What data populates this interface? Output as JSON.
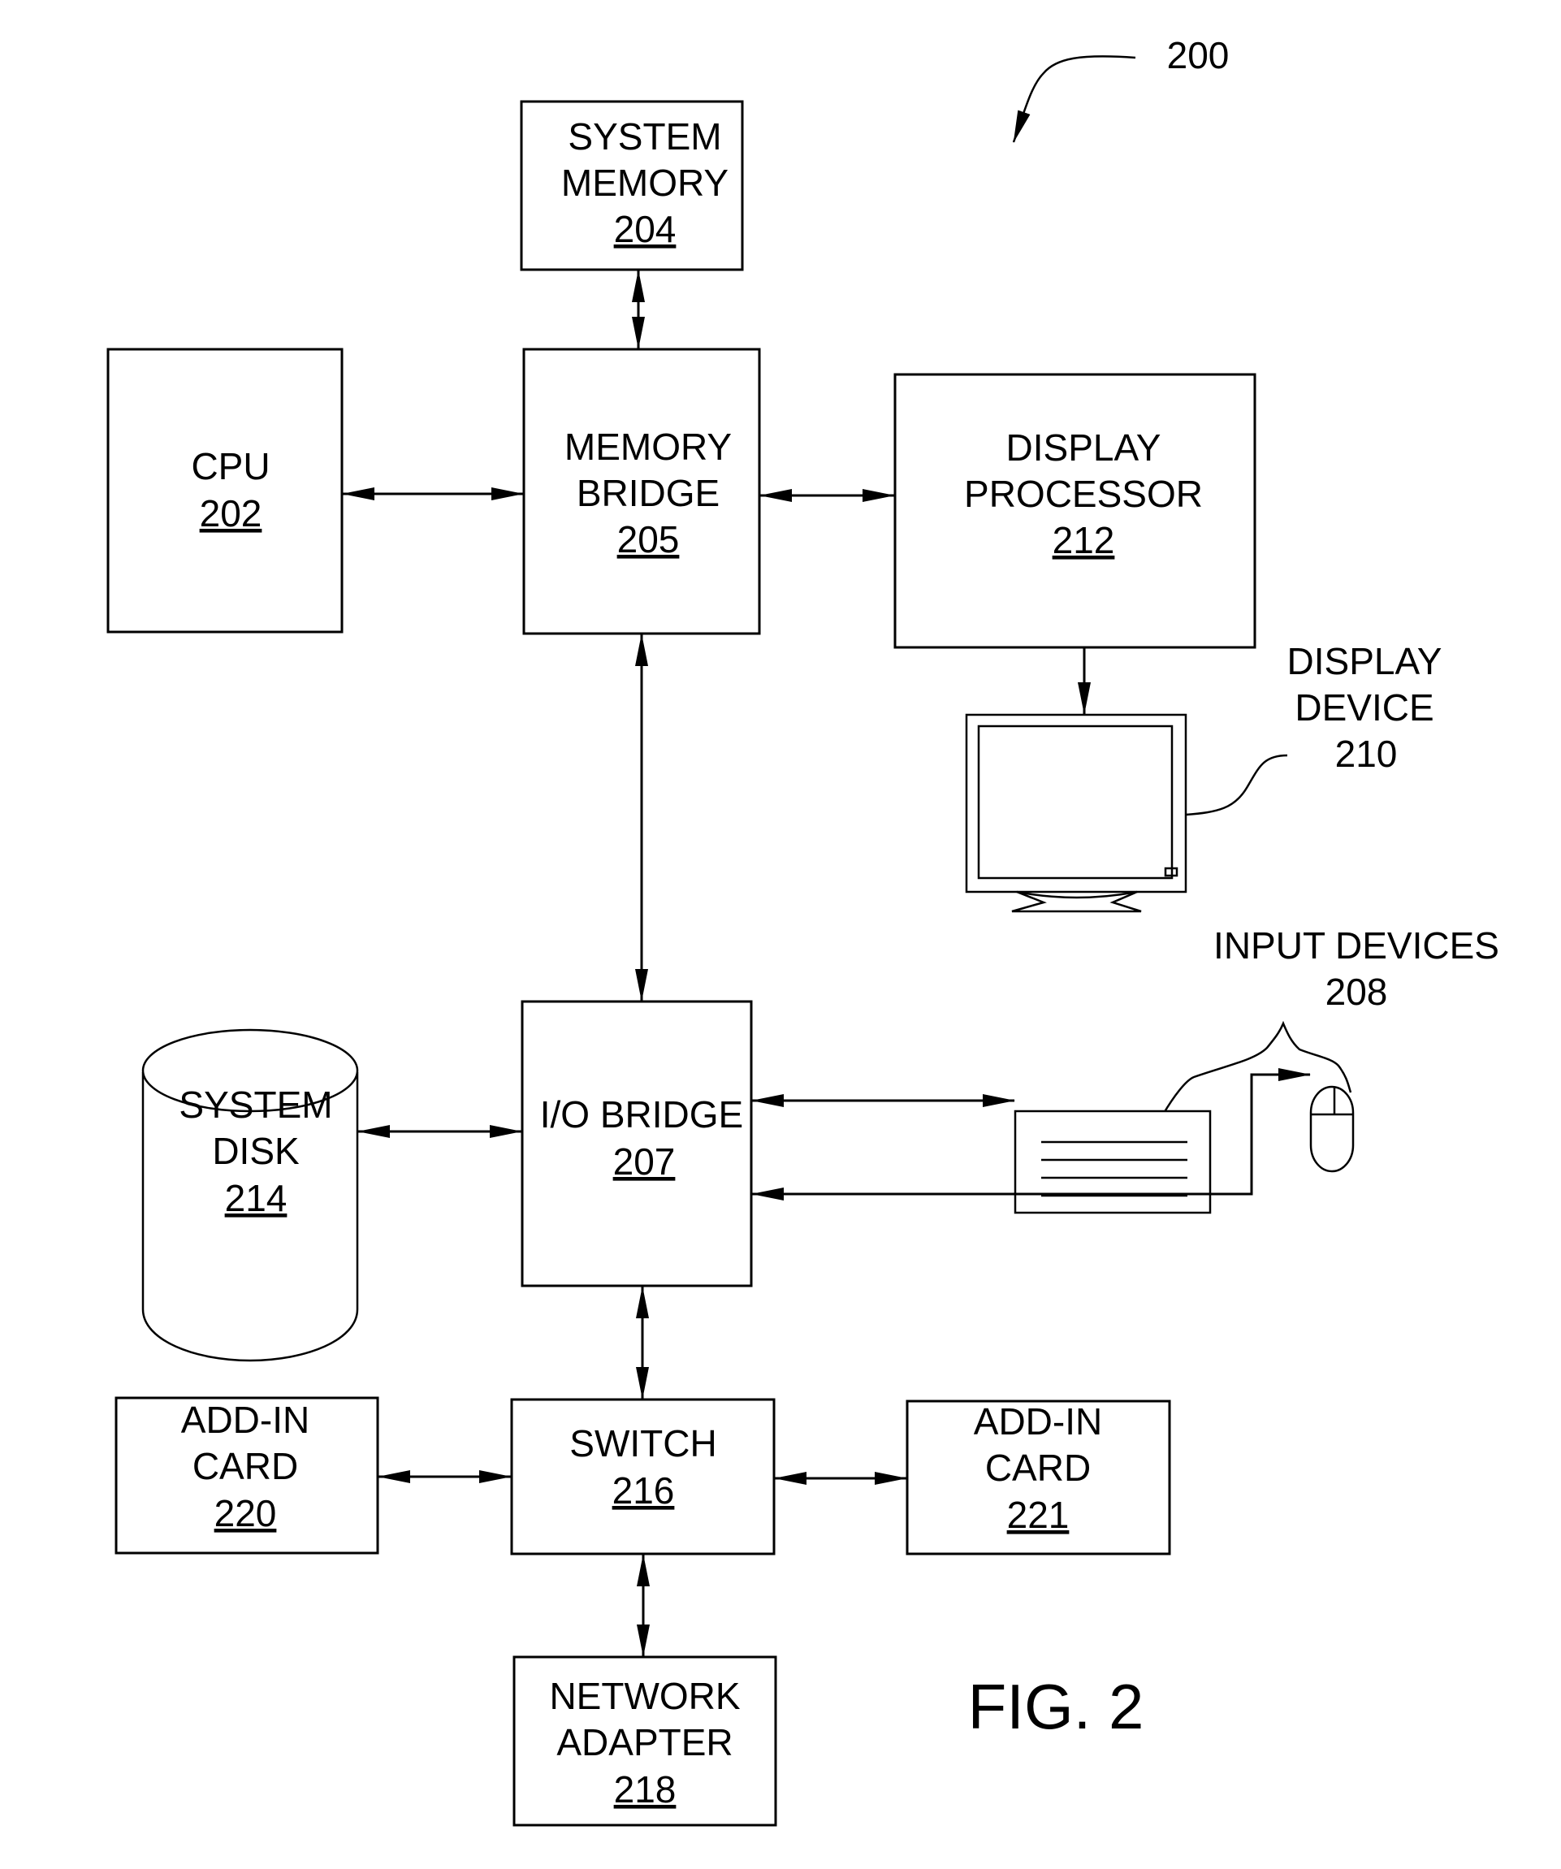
{
  "figure": {
    "label": "FIG. 2",
    "reference_number": "200"
  },
  "blocks": {
    "system_memory": {
      "lines": [
        "SYSTEM",
        "MEMORY"
      ],
      "number": "204"
    },
    "cpu": {
      "lines": [
        "CPU"
      ],
      "number": "202"
    },
    "memory_bridge": {
      "lines": [
        "MEMORY",
        "BRIDGE"
      ],
      "number": "205"
    },
    "display_processor": {
      "lines": [
        "DISPLAY",
        "PROCESSOR"
      ],
      "number": "212"
    },
    "display_device": {
      "lines": [
        "DISPLAY",
        "DEVICE"
      ],
      "number": "210"
    },
    "input_devices": {
      "lines": [
        "INPUT DEVICES"
      ],
      "number": "208"
    },
    "system_disk": {
      "lines": [
        "SYSTEM",
        "DISK"
      ],
      "number": "214"
    },
    "io_bridge": {
      "lines": [
        "I/O BRIDGE"
      ],
      "number": "207"
    },
    "add_in_card_220": {
      "lines": [
        "ADD-IN",
        "CARD"
      ],
      "number": "220"
    },
    "switch": {
      "lines": [
        "SWITCH"
      ],
      "number": "216"
    },
    "add_in_card_221": {
      "lines": [
        "ADD-IN",
        "CARD"
      ],
      "number": "221"
    },
    "network_adapter": {
      "lines": [
        "NETWORK",
        "ADAPTER"
      ],
      "number": "218"
    }
  },
  "connections": [
    {
      "from": "system_memory",
      "to": "memory_bridge",
      "type": "bidirectional"
    },
    {
      "from": "cpu",
      "to": "memory_bridge",
      "type": "bidirectional"
    },
    {
      "from": "memory_bridge",
      "to": "display_processor",
      "type": "bidirectional"
    },
    {
      "from": "display_processor",
      "to": "display_device",
      "type": "unidirectional"
    },
    {
      "from": "memory_bridge",
      "to": "io_bridge",
      "type": "bidirectional"
    },
    {
      "from": "system_disk",
      "to": "io_bridge",
      "type": "bidirectional"
    },
    {
      "from": "io_bridge",
      "to": "input_devices_keyboard",
      "type": "bidirectional"
    },
    {
      "from": "input_devices_mouse",
      "to": "io_bridge",
      "type": "bidirectional"
    },
    {
      "from": "io_bridge",
      "to": "switch",
      "type": "bidirectional"
    },
    {
      "from": "add_in_card_220",
      "to": "switch",
      "type": "bidirectional"
    },
    {
      "from": "switch",
      "to": "add_in_card_221",
      "type": "bidirectional"
    },
    {
      "from": "switch",
      "to": "network_adapter",
      "type": "bidirectional"
    }
  ]
}
